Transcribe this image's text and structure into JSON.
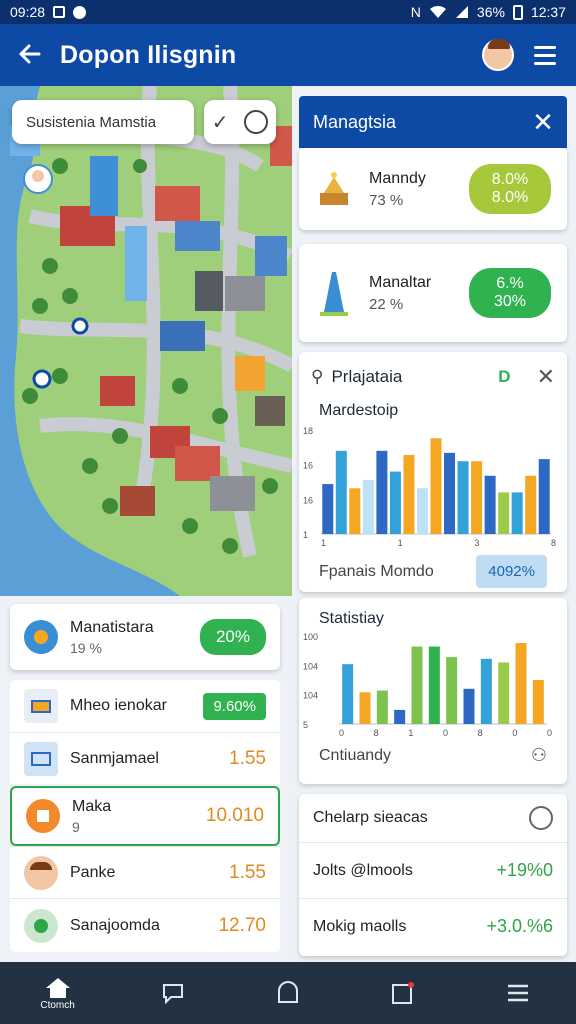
{
  "status_bar": {
    "left_text": "09:28",
    "battery": "36%",
    "time": "12:37"
  },
  "app_bar": {
    "title": "Dopon Ilisgnin"
  },
  "map": {
    "search_label": "Susistenia Mamstia"
  },
  "side_panel": {
    "header_title": "Managtsia",
    "metric_cards": [
      {
        "label": "Manndy",
        "sub": "73 %",
        "pill_top": "8.0%",
        "pill_bottom": "8.0%",
        "color": "#a7c83b"
      },
      {
        "label": "Manaltar",
        "sub": "22 %",
        "pill_top": "6.%",
        "pill_bottom": "30%",
        "color": "#2fb24f"
      }
    ],
    "chart_card": {
      "head_label": "Prlajataia",
      "head_tag": "D",
      "chart_title": "Mardestoip",
      "footer_label": "Fpanais Momdo",
      "footer_badge": "4092%"
    },
    "statistics_card": {
      "title": "Statistiay",
      "footer_label": "Cntiuandy"
    },
    "bottom_card": {
      "title": "Chelarp sieacas",
      "rows": [
        {
          "label": "Jolts @lmools",
          "value": "+19%0"
        },
        {
          "label": "Mokig maolls",
          "value": "+3.0.%6"
        }
      ]
    }
  },
  "left_list": {
    "top": {
      "label": "Manatistara",
      "sub": "19 %",
      "pill": "20%"
    },
    "rows": [
      {
        "label": "Mheo ienokar",
        "tag": "9.60%"
      },
      {
        "label": "Sanmjamael",
        "value": "1.55"
      },
      {
        "label": "Maka",
        "sub": "9",
        "value": "10.010"
      },
      {
        "label": "Panke",
        "value": "1.55"
      },
      {
        "label": "Sanajoomda",
        "value": "12.70"
      }
    ]
  },
  "bottom_nav": {
    "home_label": "Ctomch"
  },
  "chart_data": [
    {
      "type": "bar",
      "title": "Mardestoip",
      "y_ticks": [
        "18",
        "16",
        "16",
        "1"
      ],
      "x_ticks": [
        "1",
        "1",
        "3",
        "8"
      ],
      "values": [
        48,
        80,
        44,
        52,
        80,
        60,
        76,
        44,
        92,
        78,
        70,
        70,
        56,
        40,
        40,
        56,
        72
      ],
      "colors": [
        "#2c68c4",
        "#33a2d8",
        "#f5a623",
        "#bfe1f5",
        "#2c68c4",
        "#33a2d8",
        "#f5a623",
        "#bfe1f5",
        "#f5a623",
        "#2c68c4",
        "#33a2d8",
        "#f5a623",
        "#2c68c4",
        "#9bcb4a",
        "#33a2d8",
        "#f5a623",
        "#2c68c4"
      ],
      "ylim": [
        0,
        100
      ]
    },
    {
      "type": "bar",
      "title": "Statistiay",
      "y_ticks": [
        "100",
        "104",
        "104",
        "5"
      ],
      "x_ticks": [
        "0",
        "8",
        "1",
        "0",
        "8",
        "0",
        "0"
      ],
      "values": [
        68,
        36,
        38,
        16,
        88,
        88,
        76,
        40,
        74,
        70,
        92,
        50
      ],
      "colors": [
        "#33a2d8",
        "#f5a623",
        "#7cc24e",
        "#2c68c4",
        "#7cc24e",
        "#2fb24f",
        "#7cc24e",
        "#2c68c4",
        "#33a2d8",
        "#9bcb4a",
        "#f5a623",
        "#f5a623"
      ],
      "ylim": [
        0,
        100
      ]
    }
  ]
}
